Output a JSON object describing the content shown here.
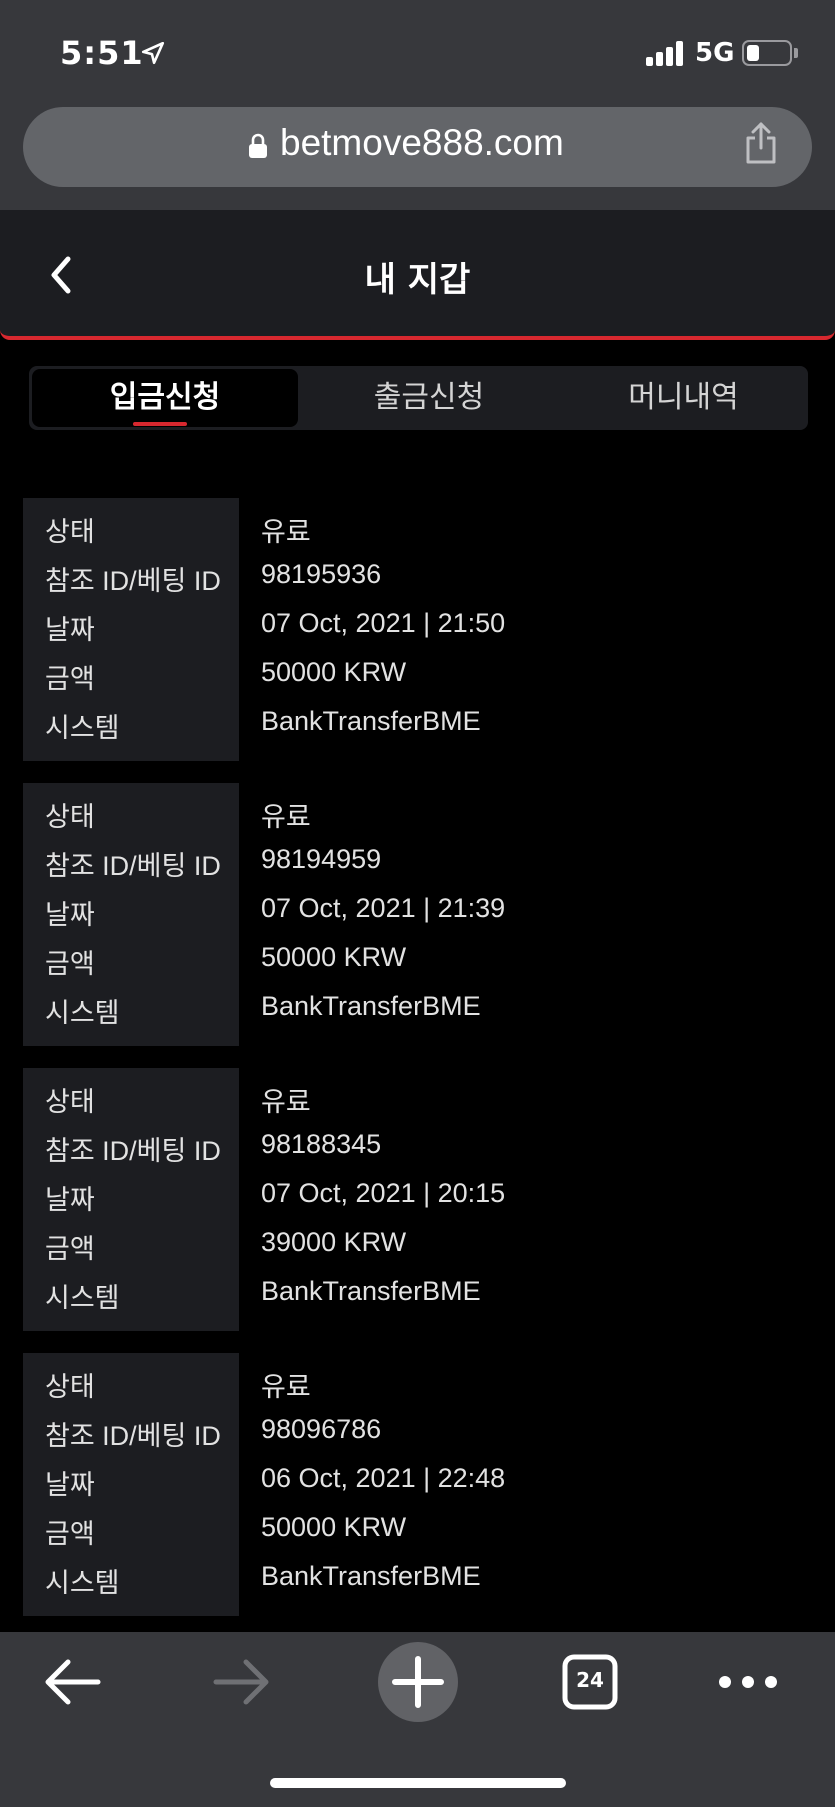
{
  "status_bar": {
    "time": "5:51",
    "network": "5G"
  },
  "browser": {
    "url": "betmove888.com",
    "tab_count": "24"
  },
  "header": {
    "title": "내 지갑"
  },
  "tabs": [
    {
      "label": "입금신청",
      "active": true
    },
    {
      "label": "출금신청",
      "active": false
    },
    {
      "label": "머니내역",
      "active": false
    }
  ],
  "records": [
    {
      "rows": [
        {
          "label": "상태",
          "value": "유료"
        },
        {
          "label": "참조 ID/베팅 ID",
          "value": "98195936"
        },
        {
          "label": "날짜",
          "value": "07 Oct, 2021 | 21:50"
        },
        {
          "label": "금액",
          "value": "50000 KRW"
        },
        {
          "label": "시스템",
          "value": "BankTransferBME"
        }
      ]
    },
    {
      "rows": [
        {
          "label": "상태",
          "value": "유료"
        },
        {
          "label": "참조 ID/베팅 ID",
          "value": "98194959"
        },
        {
          "label": "날짜",
          "value": "07 Oct, 2021 | 21:39"
        },
        {
          "label": "금액",
          "value": "50000 KRW"
        },
        {
          "label": "시스템",
          "value": "BankTransferBME"
        }
      ]
    },
    {
      "rows": [
        {
          "label": "상태",
          "value": "유료"
        },
        {
          "label": "참조 ID/베팅 ID",
          "value": "98188345"
        },
        {
          "label": "날짜",
          "value": "07 Oct, 2021 | 20:15"
        },
        {
          "label": "금액",
          "value": "39000 KRW"
        },
        {
          "label": "시스템",
          "value": "BankTransferBME"
        }
      ]
    },
    {
      "rows": [
        {
          "label": "상태",
          "value": "유료"
        },
        {
          "label": "참조 ID/베팅 ID",
          "value": "98096786"
        },
        {
          "label": "날짜",
          "value": "06 Oct, 2021 | 22:48"
        },
        {
          "label": "금액",
          "value": "50000 KRW"
        },
        {
          "label": "시스템",
          "value": "BankTransferBME"
        }
      ]
    }
  ],
  "colors": {
    "accent": "#d7282f",
    "panel": "#1c1d21",
    "chrome": "#37383c"
  },
  "icons": [
    "location-arrow-icon",
    "signal-icon",
    "battery-icon",
    "lock-icon",
    "share-icon",
    "chevron-left-icon",
    "arrow-left-icon",
    "arrow-right-icon",
    "plus-icon",
    "tabs-icon",
    "more-icon"
  ]
}
